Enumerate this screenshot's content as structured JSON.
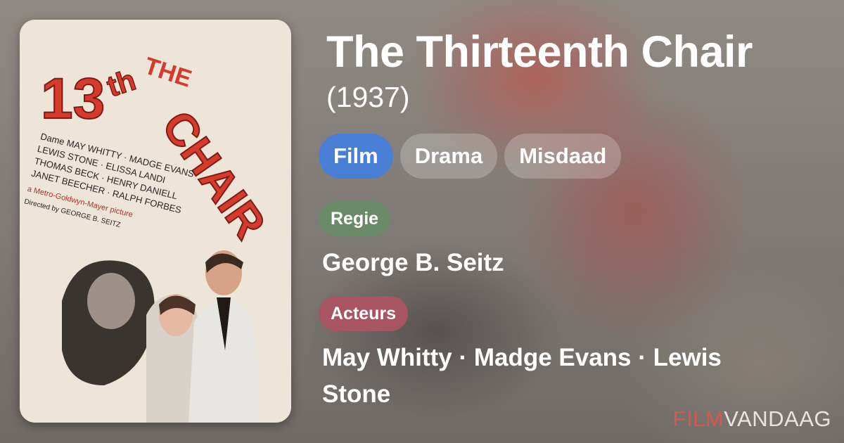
{
  "movie": {
    "title": "The Thirteenth Chair",
    "year": "(1937)"
  },
  "tags": [
    "Film",
    "Drama",
    "Misdaad"
  ],
  "sections": {
    "director_label": "Regie",
    "director": "George B. Seitz",
    "cast_label": "Acteurs",
    "cast": "May Whitty · Madge Evans · Lewis Stone"
  },
  "poster": {
    "title_word": "THE",
    "number": "13",
    "suffix": "th",
    "chair": "CHAIR",
    "credits": [
      "Dame MAY WHITTY · MADGE EVANS",
      "LEWIS STONE · ELISSA LANDI",
      "THOMAS BECK · HENRY DANIELL",
      "JANET BEECHER · RALPH FORBES"
    ],
    "studio": "a Metro-Goldwyn-Mayer picture",
    "director_credit": "Directed by GEORGE B. SEITZ"
  },
  "brand": {
    "part1": "FILM",
    "part2": "VANDAAG"
  },
  "colors": {
    "active_tag": "#4a7fd6",
    "regie": "#6b8a68",
    "acteurs": "#a85562",
    "brand_red": "#d9574a"
  }
}
